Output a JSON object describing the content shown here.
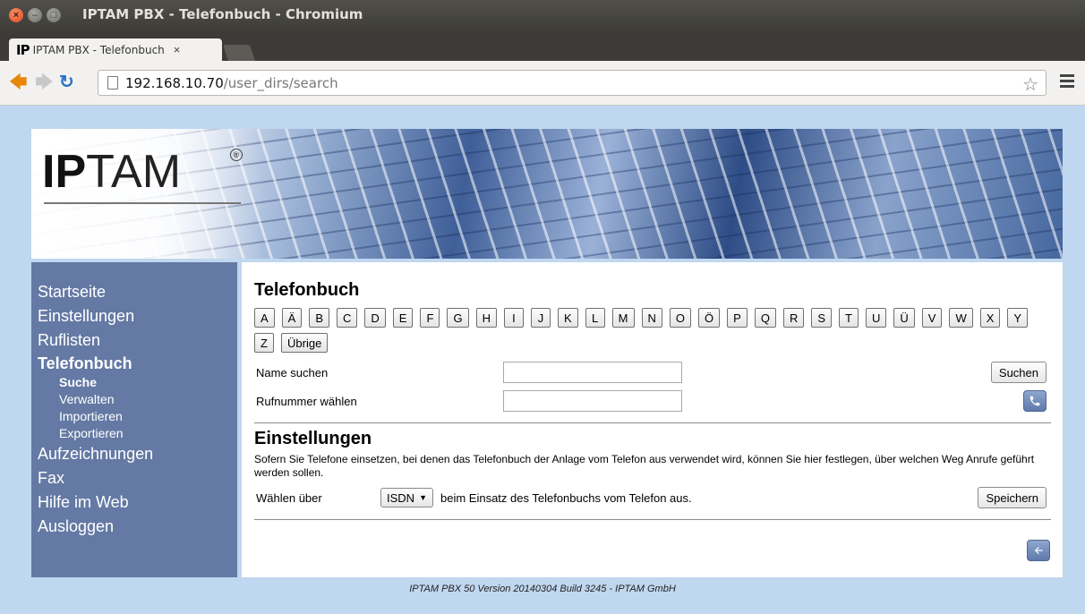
{
  "window": {
    "title": "IPTAM PBX - Telefonbuch - Chromium"
  },
  "tab": {
    "favicon_text": "IP",
    "title": "IPTAM PBX - Telefonbuch",
    "close": "×"
  },
  "address": {
    "host": "192.168.10.70",
    "path": "/user_dirs/search"
  },
  "logo": {
    "bold": "IP",
    "light": "TAM",
    "mark": "®"
  },
  "nav": {
    "startseite": "Startseite",
    "einstellungen": "Einstellungen",
    "ruflisten": "Ruflisten",
    "telefonbuch": "Telefonbuch",
    "sub": {
      "suche": "Suche",
      "verwalten": "Verwalten",
      "importieren": "Importieren",
      "exportieren": "Exportieren"
    },
    "aufzeichnungen": "Aufzeichnungen",
    "fax": "Fax",
    "hilfe": "Hilfe im Web",
    "ausloggen": "Ausloggen"
  },
  "phonebook": {
    "heading": "Telefonbuch",
    "letters": [
      "A",
      "Ä",
      "B",
      "C",
      "D",
      "E",
      "F",
      "G",
      "H",
      "I",
      "J",
      "K",
      "L",
      "M",
      "N",
      "O",
      "Ö",
      "P",
      "Q",
      "R",
      "S",
      "T",
      "U",
      "Ü",
      "V",
      "W",
      "X",
      "Y",
      "Z",
      "Übrige"
    ],
    "name_label": "Name suchen",
    "name_value": "",
    "search_button": "Suchen",
    "dial_label": "Rufnummer wählen",
    "dial_value": ""
  },
  "settings": {
    "heading": "Einstellungen",
    "description": "Sofern Sie Telefone einsetzen, bei denen das Telefonbuch der Anlage vom Telefon aus verwendet wird, können Sie hier festlegen, über welchen Weg Anrufe geführt werden sollen.",
    "dial_via_label": "Wählen über",
    "dial_via_value": "ISDN",
    "dial_via_suffix": "beim Einsatz des Telefonbuchs vom Telefon aus.",
    "save_button": "Speichern"
  },
  "footer": "IPTAM PBX 50 Version 20140304 Build 3245 - IPTAM GmbH"
}
